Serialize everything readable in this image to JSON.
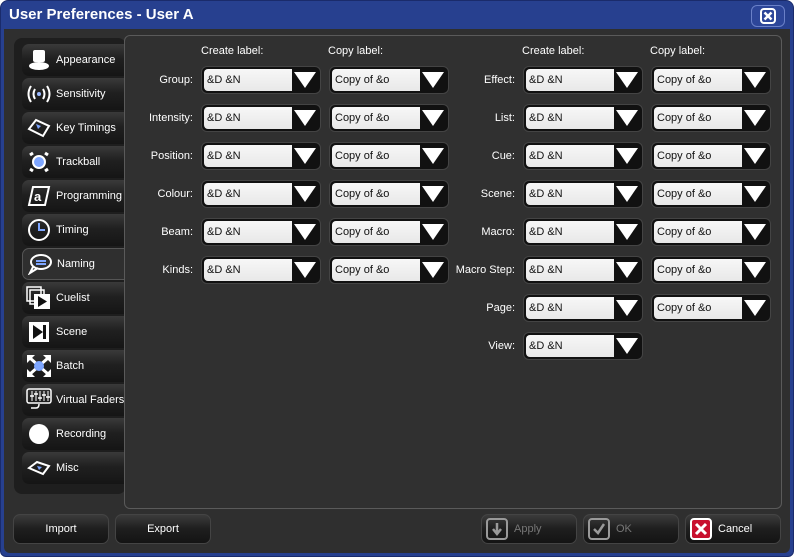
{
  "window": {
    "title": "User Preferences - User A"
  },
  "sidebar": {
    "items": [
      {
        "label": "Appearance",
        "icon": "top-hat-icon"
      },
      {
        "label": "Sensitivity",
        "icon": "signal-waves-icon"
      },
      {
        "label": "Key Timings",
        "icon": "key-icon"
      },
      {
        "label": "Trackball",
        "icon": "trackball-icon"
      },
      {
        "label": "Programming",
        "icon": "at-sign-icon"
      },
      {
        "label": "Timing",
        "icon": "clock-icon"
      },
      {
        "label": "Naming",
        "icon": "speech-bubble-icon",
        "active": true
      },
      {
        "label": "Cuelist",
        "icon": "cuelist-icon"
      },
      {
        "label": "Scene",
        "icon": "scene-icon"
      },
      {
        "label": "Batch",
        "icon": "batch-icon"
      },
      {
        "label": "Virtual Faders",
        "icon": "faders-icon"
      },
      {
        "label": "Recording",
        "icon": "record-circle-icon"
      },
      {
        "label": "Misc",
        "icon": "misc-key-icon"
      }
    ]
  },
  "naming": {
    "create_header": "Create label:",
    "copy_header": "Copy label:",
    "left": [
      {
        "label": "Group:",
        "create": "&D &N",
        "copy": "Copy of &o"
      },
      {
        "label": "Intensity:",
        "create": "&D &N",
        "copy": "Copy of &o"
      },
      {
        "label": "Position:",
        "create": "&D &N",
        "copy": "Copy of &o"
      },
      {
        "label": "Colour:",
        "create": "&D &N",
        "copy": "Copy of &o"
      },
      {
        "label": "Beam:",
        "create": "&D &N",
        "copy": "Copy of &o"
      },
      {
        "label": "Kinds:",
        "create": "&D &N",
        "copy": "Copy of &o"
      }
    ],
    "right": [
      {
        "label": "Effect:",
        "create": "&D &N",
        "copy": "Copy of &o"
      },
      {
        "label": "List:",
        "create": "&D &N",
        "copy": "Copy of &o"
      },
      {
        "label": "Cue:",
        "create": "&D &N",
        "copy": "Copy of &o"
      },
      {
        "label": "Scene:",
        "create": "&D &N",
        "copy": "Copy of &o"
      },
      {
        "label": "Macro:",
        "create": "&D &N",
        "copy": "Copy of &o"
      },
      {
        "label": "Macro Step:",
        "create": "&D &N",
        "copy": "Copy of &o"
      },
      {
        "label": "Page:",
        "create": "&D &N",
        "copy": "Copy of &o"
      },
      {
        "label": "View:",
        "create": "&D &N"
      }
    ]
  },
  "footer": {
    "import": "Import",
    "export": "Export",
    "apply": "Apply",
    "ok": "OK",
    "cancel": "Cancel"
  }
}
